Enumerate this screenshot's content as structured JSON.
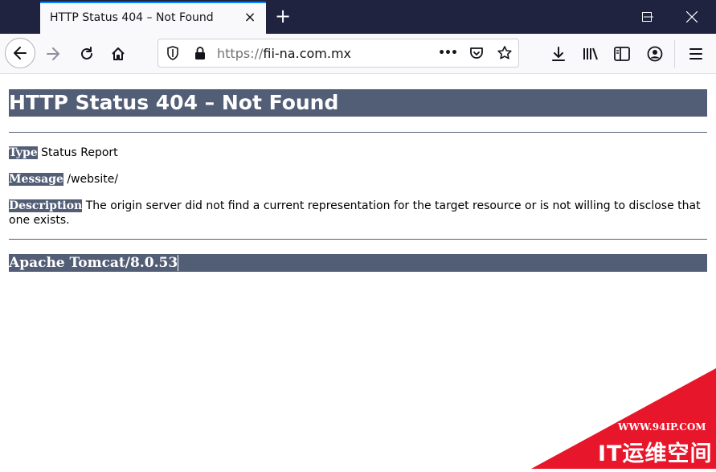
{
  "browser": {
    "tab_title": "HTTP Status 404 – Not Found",
    "tab_close": "×",
    "new_tab": "+",
    "url_scheme": "https://",
    "url_domain": "fii-na.com.mx",
    "url_more": "•••"
  },
  "page": {
    "heading": "HTTP Status 404 – Not Found",
    "type_label": "Type",
    "type_value": " Status Report",
    "message_label": "Message",
    "message_value": " /website/",
    "description_label": "Description",
    "description_value": " The origin server did not find a current representation for the target resource or is not willing to disclose that one exists.",
    "footer": "Apache Tomcat/8.0.53"
  },
  "watermark": {
    "url": "WWW.94IP.COM",
    "text": "IT运维空间"
  },
  "colors": {
    "titlebar": "#202340",
    "header_bar": "#525d76",
    "watermark_red": "#e8162b"
  }
}
